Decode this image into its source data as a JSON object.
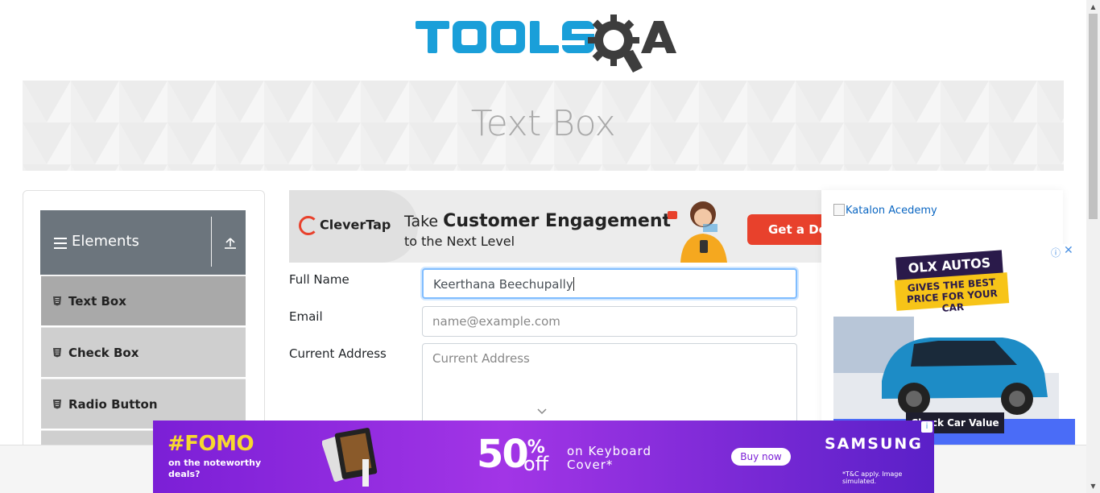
{
  "logo": {
    "text": "TOOLSQA"
  },
  "page": {
    "title": "Text Box"
  },
  "sidebar": {
    "group_title": "Elements",
    "items": [
      {
        "label": "Text Box"
      },
      {
        "label": "Check Box"
      },
      {
        "label": "Radio Button"
      }
    ]
  },
  "ad_top": {
    "brand": "CleverTap",
    "line1_prefix": "Take ",
    "line1_bold": "Customer Engagement",
    "line2": "to the Next Level",
    "cta": "Get a De"
  },
  "form": {
    "full_name": {
      "label": "Full Name",
      "value": "Keerthana Beechupally"
    },
    "email": {
      "label": "Email",
      "placeholder": "name@example.com"
    },
    "current_address": {
      "label": "Current Address",
      "placeholder": "Current Address"
    }
  },
  "side_ad": {
    "katalon_alt": "Katalon Acedemy",
    "olx_brand": "OLX AUTOS",
    "olx_tagline": "GIVES THE BEST PRICE FOR YOUR CAR",
    "olx_cta": "Check Car Value",
    "olx_info": "ⓘ",
    "olx_close": "✕"
  },
  "bottom_ad": {
    "headline": "#FOMO",
    "sub": "on the noteworthy deals?",
    "percent": "50",
    "percent_sign": "%",
    "off": "off",
    "offer": "on Keyboard Cover*",
    "cta": "Buy now",
    "brand": "SAMSUNG",
    "terms": "*T&C apply. Image simulated.",
    "adinfo": "i"
  },
  "colors": {
    "logo_blue": "#1a9fd9",
    "logo_dark": "#3d3d3d",
    "sidebar_header": "#6c757d",
    "active_item": "#a9a9a9",
    "focus_border": "#80bdff"
  }
}
